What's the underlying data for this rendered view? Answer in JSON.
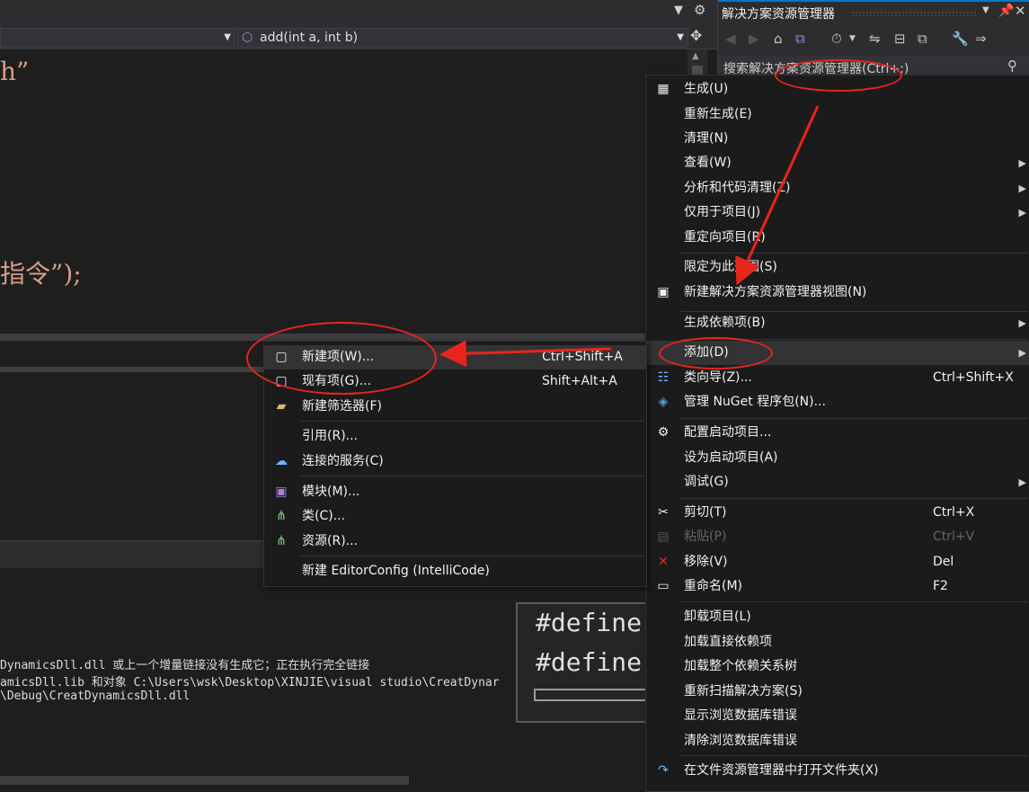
{
  "editor": {
    "function_dropdown": "add(int a, int b)",
    "code_fragment_1": "h”",
    "code_fragment_2": "指令”);"
  },
  "output": {
    "lines": [
      "DynamicsDll.dll 或上一个增量链接没有生成它；正在执行完全链接",
      "amicsDll.lib 和对象 C:\\Users\\wsk\\Desktop\\XINJIE\\visual studio\\CreatDynar",
      "\\Debug\\CreatDynamicsDll.dll"
    ]
  },
  "define_popup": {
    "line1": "#define",
    "line2": "#define"
  },
  "solution_explorer": {
    "title": "解决方案资源管理器",
    "search_placeholder": "搜索解决方案资源管理器(Ctrl+;)"
  },
  "context_menu": {
    "items": [
      {
        "label": "生成(U)",
        "icon": "build-icon"
      },
      {
        "label": "重新生成(E)"
      },
      {
        "label": "清理(N)"
      },
      {
        "label": "查看(W)",
        "submenu": true
      },
      {
        "label": "分析和代码清理(Z)",
        "submenu": true
      },
      {
        "label": "仅用于项目(J)",
        "submenu": true
      },
      {
        "label": "重定向项目(R)"
      },
      {
        "label": "限定为此范围(S)"
      },
      {
        "label": "新建解决方案资源管理器视图(N)",
        "icon": "new-view-icon"
      },
      {
        "label": "生成依赖项(B)",
        "submenu": true
      },
      {
        "label": "添加(D)",
        "submenu": true,
        "highlighted": true
      },
      {
        "label": "类向导(Z)...",
        "shortcut": "Ctrl+Shift+X",
        "icon": "class-wizard-icon"
      },
      {
        "label": "管理 NuGet 程序包(N)...",
        "icon": "nuget-icon"
      },
      {
        "label": "配置启动项目...",
        "icon": "gear-icon"
      },
      {
        "label": "设为启动项目(A)"
      },
      {
        "label": "调试(G)",
        "submenu": true
      },
      {
        "label": "剪切(T)",
        "shortcut": "Ctrl+X",
        "icon": "scissors-icon"
      },
      {
        "label": "粘贴(P)",
        "shortcut": "Ctrl+V",
        "disabled": true,
        "icon": "paste-icon"
      },
      {
        "label": "移除(V)",
        "shortcut": "Del",
        "icon": "remove-icon"
      },
      {
        "label": "重命名(M)",
        "shortcut": "F2",
        "icon": "rename-icon"
      },
      {
        "label": "卸载项目(L)"
      },
      {
        "label": "加载直接依赖项"
      },
      {
        "label": "加载整个依赖关系树"
      },
      {
        "label": "重新扫描解决方案(S)"
      },
      {
        "label": "显示浏览数据库错误"
      },
      {
        "label": "清除浏览数据库错误"
      },
      {
        "label": "在文件资源管理器中打开文件夹(X)",
        "icon": "open-folder-icon"
      }
    ]
  },
  "add_submenu": {
    "items": [
      {
        "label": "新建项(W)...",
        "shortcut": "Ctrl+Shift+A",
        "highlighted": true,
        "icon": "new-item-icon"
      },
      {
        "label": "现有项(G)...",
        "shortcut": "Shift+Alt+A",
        "icon": "existing-item-icon"
      },
      {
        "label": "新建筛选器(F)",
        "icon": "new-filter-icon"
      },
      {
        "label": "引用(R)..."
      },
      {
        "label": "连接的服务(C)",
        "icon": "connected-service-icon"
      },
      {
        "label": "模块(M)...",
        "icon": "module-icon"
      },
      {
        "label": "类(C)...",
        "icon": "class-icon"
      },
      {
        "label": "资源(R)...",
        "icon": "resource-icon"
      },
      {
        "label": "新建 EditorConfig (IntelliCode)"
      }
    ]
  },
  "colors": {
    "accent": "#007acc",
    "annotation": "#e8251c",
    "menu_bg": "#1b1b1c"
  }
}
